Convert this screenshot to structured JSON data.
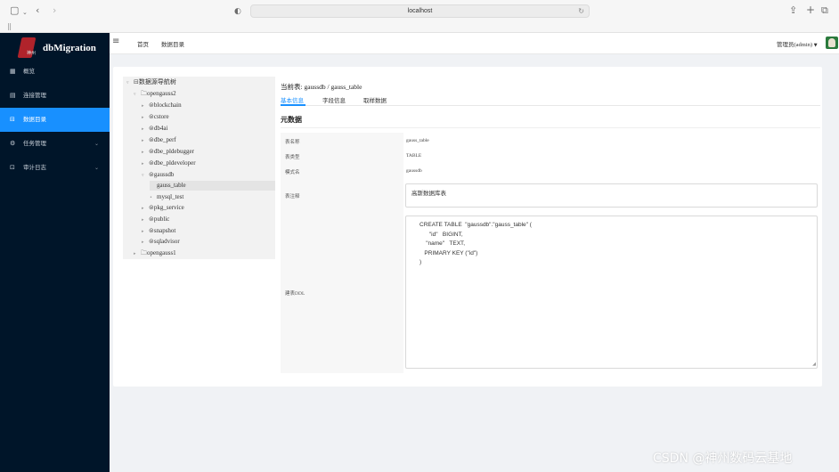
{
  "browser": {
    "url": "localhost",
    "icons": [
      "sidebar-toggle-icon",
      "chevron-down-icon",
      "back-icon",
      "forward-icon",
      "privacy-icon",
      "reload-icon",
      "share-icon",
      "new-tab-icon",
      "tabs-overview-icon",
      "grid-icon"
    ]
  },
  "sidebar": {
    "logo_text": "dbMigration",
    "logo_sub": "神州",
    "items": [
      {
        "label": "概览",
        "icon": "grid-icon",
        "active": false
      },
      {
        "label": "连接管理",
        "icon": "database-connection-icon",
        "active": false
      },
      {
        "label": "数据目录",
        "icon": "catalog-icon",
        "active": true
      },
      {
        "label": "任务管理",
        "icon": "gear-icon",
        "active": false,
        "expandable": true
      },
      {
        "label": "审计日志",
        "icon": "audit-icon",
        "active": false,
        "expandable": true
      }
    ]
  },
  "header": {
    "breadcrumbs": [
      "首页",
      "数据目录"
    ],
    "user": "管理员(admin)"
  },
  "tree": {
    "root": "数据源导航树",
    "source1": "opengauss2",
    "schemas_before": [
      "blockchain",
      "cstore",
      "db4ai",
      "dbe_perf",
      "dbe_pldebugger",
      "dbe_pldeveloper"
    ],
    "schema_open": "gaussdb",
    "tables": [
      "gauss_table",
      "mysql_test"
    ],
    "schemas_after": [
      "pkg_service",
      "public",
      "snapshot",
      "sqladvisor"
    ],
    "source2": "opengauss1"
  },
  "detail": {
    "current_label": "当前表:",
    "current_value": "gaussdb / gauss_table",
    "tabs": [
      "基本信息",
      "字段信息",
      "取样数据"
    ],
    "active_tab": 0,
    "section_title": "元数据",
    "fields": {
      "table_name_label": "表名称",
      "table_name_value": "gauss_table",
      "table_type_label": "表类型",
      "table_type_value": "TABLE",
      "schema_label": "模式名",
      "schema_value": "gaussdb",
      "remark_label": "表注释",
      "remark_value": "高斯数据库表",
      "ddl_label": "建表DDL"
    },
    "ddl_lines": [
      "CREATE TABLE  \"gaussdb\".\"gauss_table\" (",
      "      \"id\"   BIGINT,",
      "    \"name\"   TEXT,",
      "   PRIMARY KEY (\"id\")",
      ")"
    ]
  },
  "watermark": "CSDN @神州数码云基地",
  "colors": {
    "sidebar_bg": "#001529",
    "accent": "#1890ff",
    "page_bg": "#f0f2f5"
  }
}
